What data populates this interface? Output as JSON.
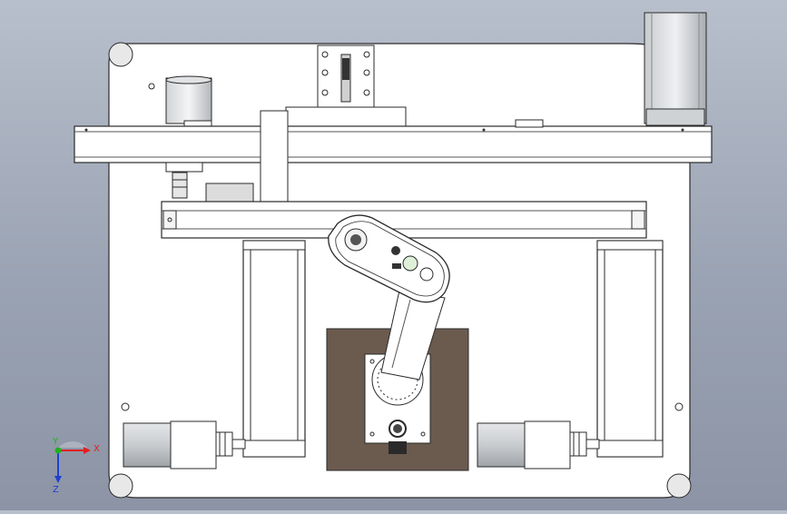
{
  "viewport": {
    "background_top": "#b8bfcc",
    "background_bottom": "#8c94a5",
    "part_fill": "#ffffff",
    "edge_color": "#2a2a2a",
    "base_plate_color": "#6b5a4e",
    "motor_fill": "#c9cccf"
  },
  "triad": {
    "x_label": "X",
    "y_label": "Y",
    "z_label": "Z",
    "x_color": "#e02020",
    "y_color": "#20b020",
    "z_color": "#2040d0"
  }
}
